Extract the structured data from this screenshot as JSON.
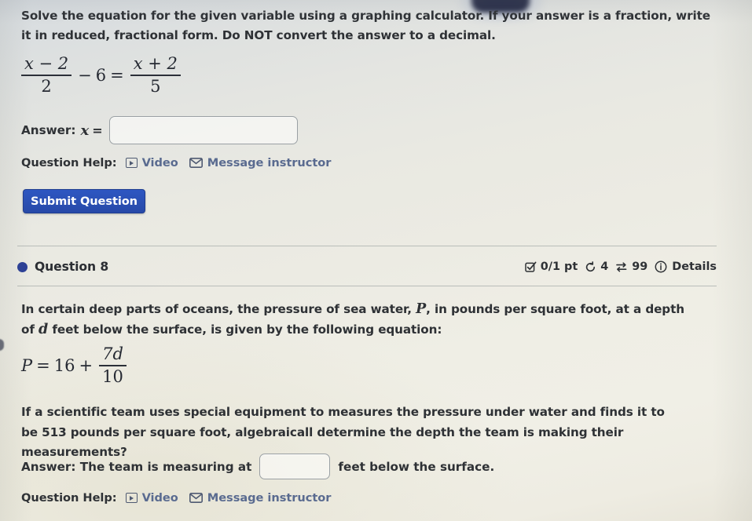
{
  "question_7": {
    "prompt": "Solve the equation for the given variable using a graphing calculator. If your answer is a fraction, write it in reduced, fractional form. Do NOT convert the answer to a decimal.",
    "equation": {
      "left_fraction_num": "x − 2",
      "left_fraction_den": "2",
      "minus": "−",
      "six": "6",
      "equals": "=",
      "right_fraction_num": "x + 2",
      "right_fraction_den": "5"
    },
    "answer_label": "Answer:",
    "answer_var": "x",
    "answer_equals": "=",
    "answer_value": "",
    "answer_placeholder": "",
    "help_label": "Question Help:",
    "video_link": "Video",
    "message_link": "Message instructor",
    "submit_label": "Submit Question"
  },
  "question_8": {
    "title": "Question 8",
    "points": "0/1 pt",
    "attempts": "4",
    "versions": "99",
    "details_label": "Details",
    "body_part_1": "In certain deep parts of oceans, the pressure of sea water, ",
    "body_var_P": "P",
    "body_part_2": ", in pounds per square foot, at a depth of ",
    "body_var_d": "d",
    "body_part_3": " feet below the surface, is given by the following equation:",
    "equation": {
      "P": "P",
      "equals": "=",
      "sixteen": "16",
      "plus": "+",
      "fraction_num": "7d",
      "fraction_den": "10"
    },
    "body_part_4": "If a scientific team uses special equipment to measures the pressure under water and finds it to be 513 pounds per square foot, algebraicall determine the depth the team is making their measurements?",
    "answer_prefix": "Answer: The team is measuring at",
    "answer_value": "",
    "answer_placeholder": "",
    "answer_suffix": "feet below the surface.",
    "help_label": "Question Help:",
    "video_link": "Video",
    "message_link": "Message instructor"
  },
  "icons": {
    "video": "video-play-icon",
    "mail": "envelope-icon",
    "check_square": "check-square-icon",
    "retry": "retry-circular-arrow-icon",
    "swap": "swap-arrows-icon",
    "info": "info-circle-icon",
    "bullet": "question-status-dot"
  },
  "colors": {
    "submit_button": "#2749a8",
    "bullet": "#2b3f96",
    "link": "#5a6b90",
    "text": "#2e3135"
  }
}
